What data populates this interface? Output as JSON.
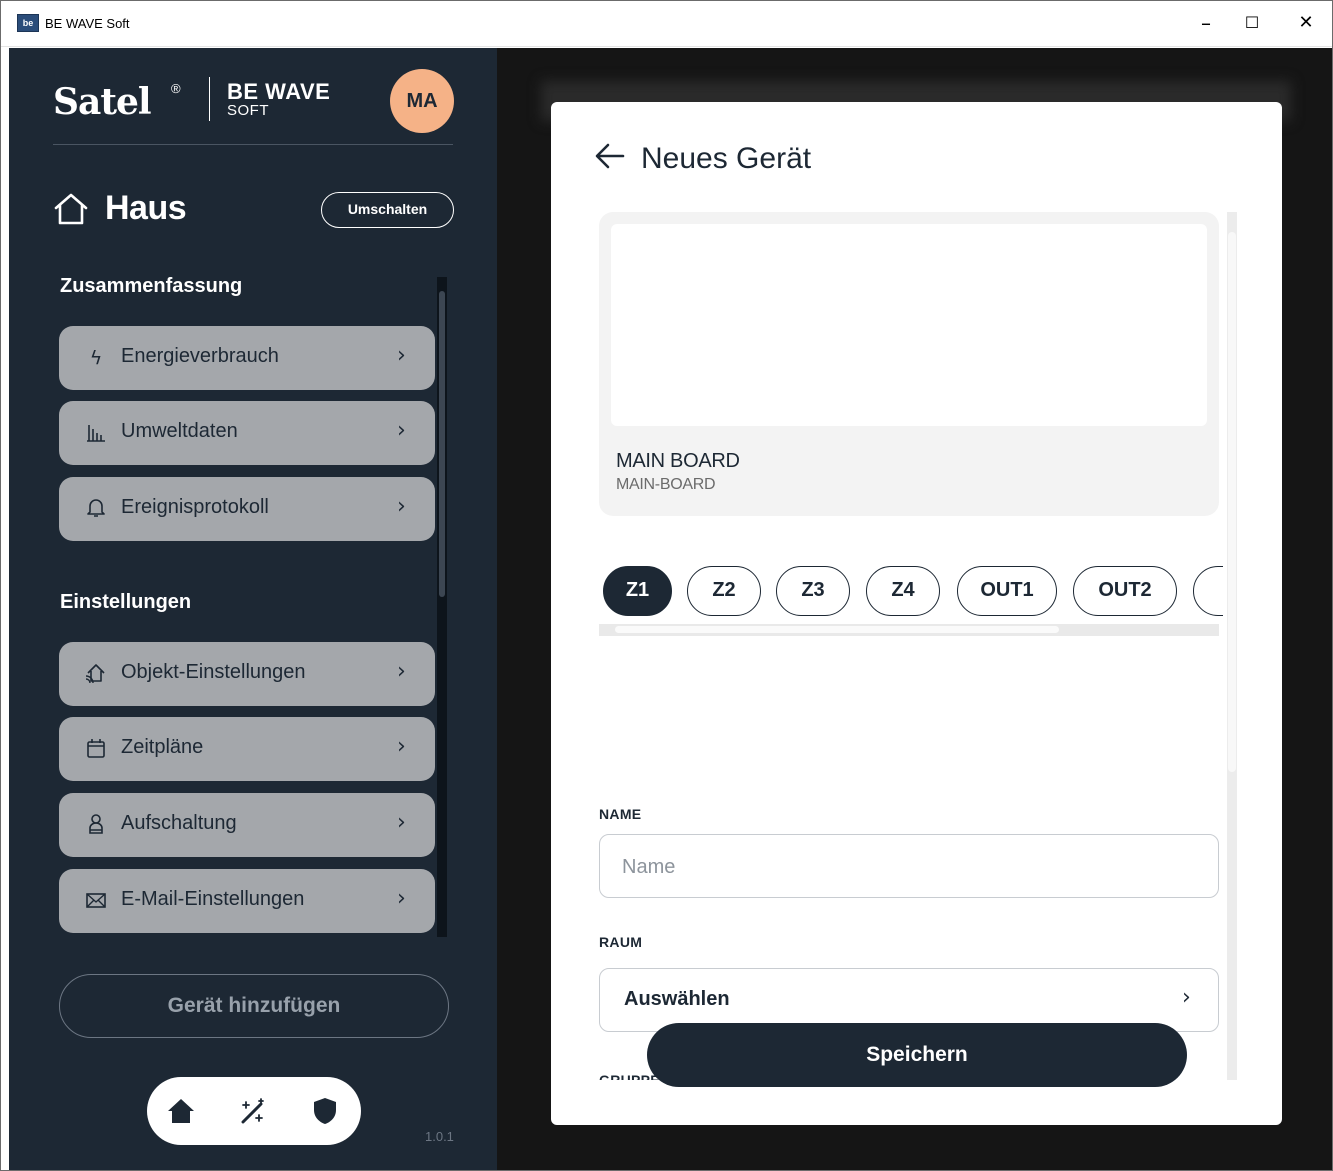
{
  "window": {
    "app_icon_text": "be",
    "title": "BE WAVE Soft",
    "minimize": "–",
    "maximize": "☐",
    "close": "✕"
  },
  "sidebar": {
    "logo_text": "Satel",
    "logo_mark": "®",
    "brand_line1": "BE WAVE",
    "brand_line2": "SOFT",
    "avatar_initials": "MA",
    "location_name": "Haus",
    "switch_label": "Umschalten",
    "summary_heading": "Zusammenfassung",
    "summary_items": [
      {
        "label": "Energieverbrauch",
        "icon": "lightning-icon"
      },
      {
        "label": "Umweltdaten",
        "icon": "bar-chart-icon"
      },
      {
        "label": "Ereignisprotokoll",
        "icon": "bell-icon"
      }
    ],
    "settings_heading": "Einstellungen",
    "settings_items": [
      {
        "label": "Objekt-Einstellungen",
        "icon": "house-wifi-icon"
      },
      {
        "label": "Zeitpläne",
        "icon": "calendar-icon"
      },
      {
        "label": "Aufschaltung",
        "icon": "person-icon"
      },
      {
        "label": "E-Mail-Einstellungen",
        "icon": "mail-icon"
      }
    ],
    "add_device_label": "Gerät hinzufügen",
    "dock": [
      "home-icon",
      "magic-wand-icon",
      "shield-icon"
    ],
    "version": "1.0.1"
  },
  "modal": {
    "title": "Neues Gerät",
    "device": {
      "name": "MAIN BOARD",
      "model": "MAIN-BOARD"
    },
    "channels": [
      "Z1",
      "Z2",
      "Z3",
      "Z4",
      "OUT1",
      "OUT2"
    ],
    "active_channel": "Z1",
    "name_label": "NAME",
    "name_placeholder": "Name",
    "name_value": "",
    "room_label": "RAUM",
    "room_value": "Auswählen",
    "group_label": "GRUPPE",
    "save_label": "Speichern"
  },
  "colors": {
    "sidebar_bg": "#1d2834",
    "menu_item_bg": "#a4a7ab",
    "avatar_bg": "#f5b287",
    "primary": "#1d2834"
  }
}
